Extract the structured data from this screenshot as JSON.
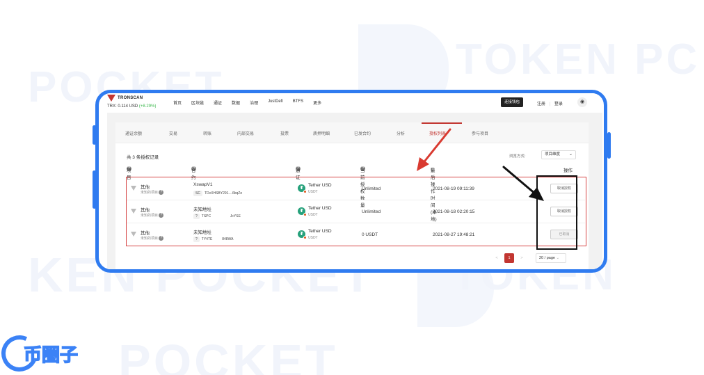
{
  "watermark": {
    "line1": "TOKEN PC",
    "line2": "POCKET",
    "line3": "KEN POCKET",
    "line4": "TOKEN",
    "line5": "POCKET"
  },
  "app": {
    "logo": "TRONSCAN",
    "trx_price": "TRX: 0.114 USD",
    "trx_change": "(+8.29%)"
  },
  "nav": {
    "items": [
      "首页",
      "区块链",
      "通证",
      "数据",
      "治理",
      "JustDefi",
      "BTFS",
      "更多"
    ],
    "connect_wallet": "连接钱包",
    "register": "注册",
    "divider": "|",
    "login": "登录"
  },
  "tabs": {
    "items": [
      "通证余额",
      "交易",
      "转账",
      "内部交易",
      "投票",
      "质押明细",
      "已发合约",
      "分析",
      "授权列表",
      "参与项目"
    ],
    "active_index": 8
  },
  "list": {
    "summary": "共 3 条授权记录",
    "view_label": "浏览方式:",
    "view_value": "项目维度",
    "columns": {
      "project": "项目",
      "contract": "合约",
      "token": "通证",
      "amount": "当前授权数量",
      "time": "最后操作时间(本地)",
      "action": "操作"
    },
    "rows": [
      {
        "project": "其他",
        "project_sub": "未知的项目",
        "contract": "XswapV1",
        "addr_tag": "SC",
        "address": "TDvXHSBY291....6bqZe",
        "token": "Tether USD",
        "token_symbol": "USDT",
        "amount": "Unlimited",
        "time": "2021-08-19 09:11:39",
        "action": "取消授权"
      },
      {
        "project": "其他",
        "project_sub": "未知的项目",
        "contract": "未知地址",
        "addr_tag": "?",
        "address": "TSPC                    JcYSE",
        "token": "Tether USD",
        "token_symbol": "USDT",
        "amount": "Unlimited",
        "time": "2021-08-18 02:20:15",
        "action": "取消授权"
      },
      {
        "project": "其他",
        "project_sub": "未知的项目",
        "contract": "未知地址",
        "addr_tag": "?",
        "address": "TY4TE          848WA",
        "token": "Tether USD",
        "token_symbol": "USDT",
        "amount": "0 USDT",
        "time": "2021-08-27 19:48:21",
        "action": "已取消"
      }
    ]
  },
  "pagination": {
    "prev": "<",
    "current": "1",
    "next": ">",
    "page_size": "20 / page"
  },
  "brand": {
    "text": "币圈子"
  },
  "colors": {
    "frame": "#2f7bf0",
    "accent_red": "#c23631",
    "tether_green": "#26a17b"
  }
}
